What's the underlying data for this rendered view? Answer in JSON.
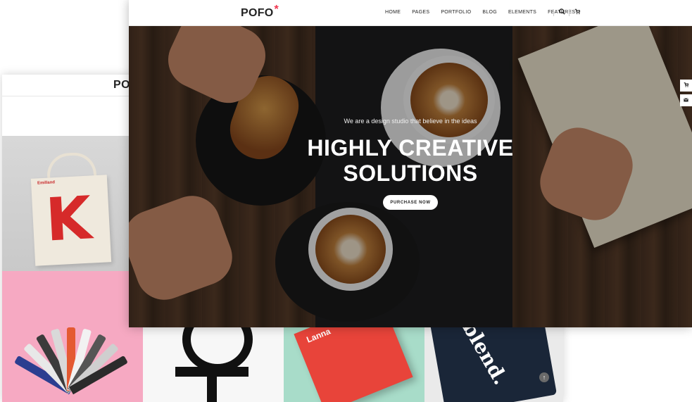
{
  "back": {
    "logo": "PO",
    "bag_brand": "Emilland",
    "bag_letter": "K",
    "book_text": "Lanna",
    "shirt_text": "blend."
  },
  "front": {
    "logo": "POFO",
    "logo_mark": "*",
    "nav": [
      "HOME",
      "PAGES",
      "PORTFOLIO",
      "BLOG",
      "ELEMENTS",
      "FEATURES"
    ],
    "icons": {
      "search": "search-icon",
      "cart": "cart-icon",
      "mail": "mail-icon",
      "scroll_top": "arrow-up-icon"
    },
    "accent": "#f0344e"
  },
  "hero": {
    "subtitle": "We are a design studio that believe in the ideas",
    "title_line1": "HIGHLY CREATIVE",
    "title_line2": "SOLUTIONS",
    "button_label": "PURCHASE NOW"
  }
}
